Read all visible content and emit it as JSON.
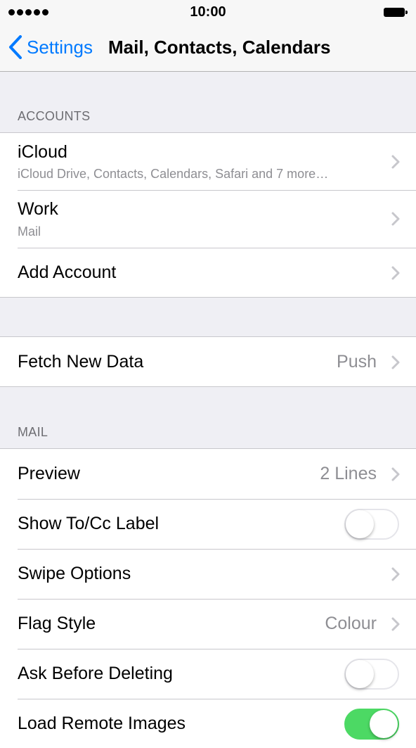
{
  "status_bar": {
    "time": "10:00"
  },
  "nav": {
    "back_label": "Settings",
    "title": "Mail, Contacts, Calendars"
  },
  "accounts": {
    "header": "ACCOUNTS",
    "icloud": {
      "title": "iCloud",
      "subtitle": "iCloud Drive, Contacts, Calendars, Safari and 7 more…"
    },
    "work": {
      "title": "Work",
      "subtitle": "Mail"
    },
    "add_account": {
      "title": "Add Account"
    }
  },
  "fetch": {
    "title": "Fetch New Data",
    "value": "Push"
  },
  "mail": {
    "header": "MAIL",
    "preview": {
      "title": "Preview",
      "value": "2 Lines"
    },
    "show_to_cc": {
      "title": "Show To/Cc Label",
      "on": false
    },
    "swipe_options": {
      "title": "Swipe Options"
    },
    "flag_style": {
      "title": "Flag Style",
      "value": "Colour"
    },
    "ask_before_deleting": {
      "title": "Ask Before Deleting",
      "on": false
    },
    "load_remote_images": {
      "title": "Load Remote Images",
      "on": true
    }
  },
  "colors": {
    "accent": "#007aff",
    "toggle_on": "#4cd964",
    "background": "#efeff4"
  },
  "icons": [
    "chevron-left-icon",
    "chevron-right-icon",
    "signal-icon",
    "battery-icon"
  ]
}
